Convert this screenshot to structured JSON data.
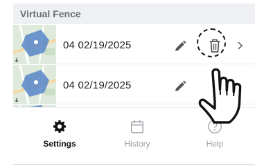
{
  "header": {
    "title": "Virtual Fence"
  },
  "fences": [
    {
      "label": "04 02/19/2025",
      "thumbnail": "map-thumbnail",
      "edit_icon": "pencil-icon",
      "delete_icon": "trash-icon",
      "open_icon": "chevron-right-icon"
    },
    {
      "label": "04 02/19/2025",
      "thumbnail": "map-thumbnail",
      "edit_icon": "pencil-icon"
    }
  ],
  "tabs": [
    {
      "label": "Settings",
      "icon": "gear-icon",
      "active": true
    },
    {
      "label": "History",
      "icon": "calendar-icon",
      "active": false
    },
    {
      "label": "Help",
      "icon": "question-circle-icon",
      "active": false
    }
  ],
  "overlay": {
    "highlight": "dashed-circle",
    "pointer": "hand-pointer-icon"
  },
  "colors": {
    "header_bg": "#eef0f4",
    "header_text": "#6b6e75",
    "fence_fill": "#4f7fc7",
    "active_tab": "#111111",
    "inactive_tab": "#9a9da3"
  }
}
